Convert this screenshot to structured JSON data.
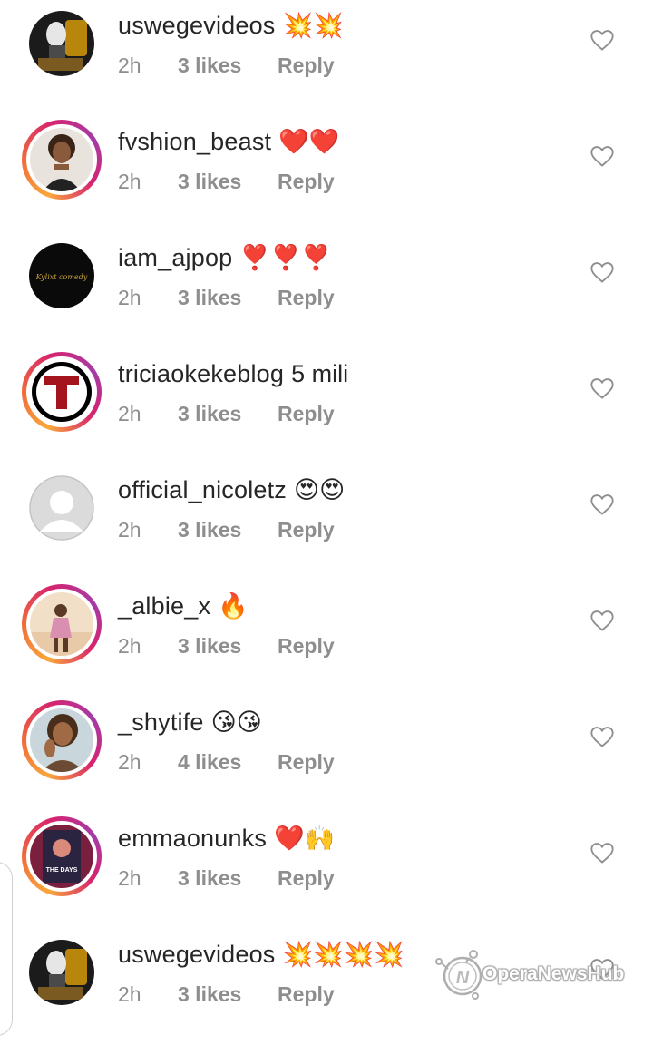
{
  "comments": [
    {
      "username": "uswegevideos",
      "text": "",
      "emoji": "💥💥",
      "time": "2h",
      "likes": "3 likes",
      "reply": "Reply",
      "avatar": "masked-figure-avatar",
      "story_ring": false
    },
    {
      "username": "fvshion_beast",
      "text": "",
      "emoji": "❤️❤️",
      "time": "2h",
      "likes": "3 likes",
      "reply": "Reply",
      "avatar": "woman-portrait-avatar",
      "story_ring": true
    },
    {
      "username": "iam_ajpop",
      "text": "",
      "emoji": "❣️❣️❣️",
      "time": "2h",
      "likes": "3 likes",
      "reply": "Reply",
      "avatar": "kylixt-comedy-logo-avatar",
      "story_ring": false
    },
    {
      "username": "triciaokekeblog",
      "text": "5 mili",
      "emoji": "",
      "time": "2h",
      "likes": "3 likes",
      "reply": "Reply",
      "avatar": "letter-t-logo-avatar",
      "story_ring": true
    },
    {
      "username": "official_nicoletz",
      "text": "",
      "emoji": "😍😍",
      "time": "2h",
      "likes": "3 likes",
      "reply": "Reply",
      "avatar": "default-person-avatar",
      "story_ring": false
    },
    {
      "username": "_albie_x",
      "text": "",
      "emoji": "🔥",
      "time": "2h",
      "likes": "3 likes",
      "reply": "Reply",
      "avatar": "woman-outdoor-avatar",
      "story_ring": true
    },
    {
      "username": "_shytife",
      "text": "",
      "emoji": "😘😘",
      "time": "2h",
      "likes": "4 likes",
      "reply": "Reply",
      "avatar": "woman-selfie-avatar",
      "story_ring": true
    },
    {
      "username": "emmaonunks",
      "text": "",
      "emoji": "❤️🙌",
      "time": "2h",
      "likes": "3 likes",
      "reply": "Reply",
      "avatar": "the-days-poster-avatar",
      "story_ring": true
    },
    {
      "username": "uswegevideos",
      "text": "",
      "emoji": "💥💥💥💥",
      "time": "2h",
      "likes": "3 likes",
      "reply": "Reply",
      "avatar": "masked-figure-avatar",
      "story_ring": false
    }
  ],
  "avatar_logo_text": {
    "kylixt": "Kylixt comedy",
    "poster": "THE DAYS"
  },
  "watermark": {
    "text": "OperaNewsHub"
  },
  "colors": {
    "username": "#262626",
    "meta": "#8e8e8e",
    "heart_outline": "#8e8e8e",
    "ring_start": "#f9a73b",
    "ring_end": "#d6246e"
  }
}
